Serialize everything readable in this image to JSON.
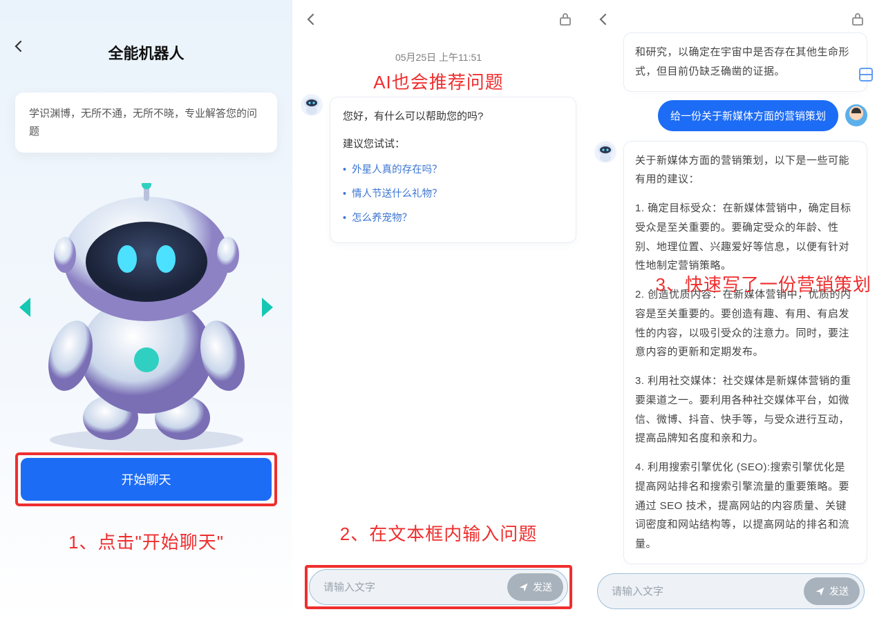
{
  "panel1": {
    "title": "全能机器人",
    "intro": "学识渊博，无所不通，无所不晓，专业解答您的问题",
    "start_label": "开始聊天",
    "caption": "1、点击\"开始聊天\""
  },
  "panel2": {
    "timestamp": "05月25日  上午11:51",
    "overlay": "AI也会推荐问题",
    "greeting": "您好，有什么可以帮助您的吗?",
    "hint": "建议您试试：",
    "suggestions": [
      "外星人真的存在吗？",
      "情人节送什么礼物？",
      "怎么养宠物？"
    ],
    "caption": "2、在文本框内输入问题",
    "input_placeholder": "请输入文字",
    "send_label": "发送"
  },
  "panel3": {
    "overlay": "3、快速写了一份营销策划",
    "bot_reply_top": "和研究，以确定在宇宙中是否存在其他生命形式，但目前仍缺乏确凿的证据。",
    "user_msg": "给一份关于新媒体方面的营销策划",
    "bot_reply_main": {
      "intro": "关于新媒体方面的营销策划，以下是一些可能有用的建议：",
      "p1": "1. 确定目标受众：在新媒体营销中，确定目标受众是至关重要的。要确定受众的年龄、性别、地理位置、兴趣爱好等信息，以便有针对性地制定营销策略。",
      "p2": "2. 创造优质内容：在新媒体营销中，优质的内容是至关重要的。要创造有趣、有用、有启发性的内容，以吸引受众的注意力。同时，要注意内容的更新和定期发布。",
      "p3": "3. 利用社交媒体：社交媒体是新媒体营销的重要渠道之一。要利用各种社交媒体平台，如微信、微博、抖音、快手等，与受众进行互动，提高品牌知名度和亲和力。",
      "p4": "4. 利用搜索引擎优化 (SEO):搜索引擎优化是提高网站排名和搜索引擎流量的重要策略。要通过 SEO 技术，提高网站的内容质量、关键词密度和网站结构等，以提高网站的排名和流量。"
    },
    "input_placeholder": "请输入文字",
    "send_label": "发送"
  }
}
